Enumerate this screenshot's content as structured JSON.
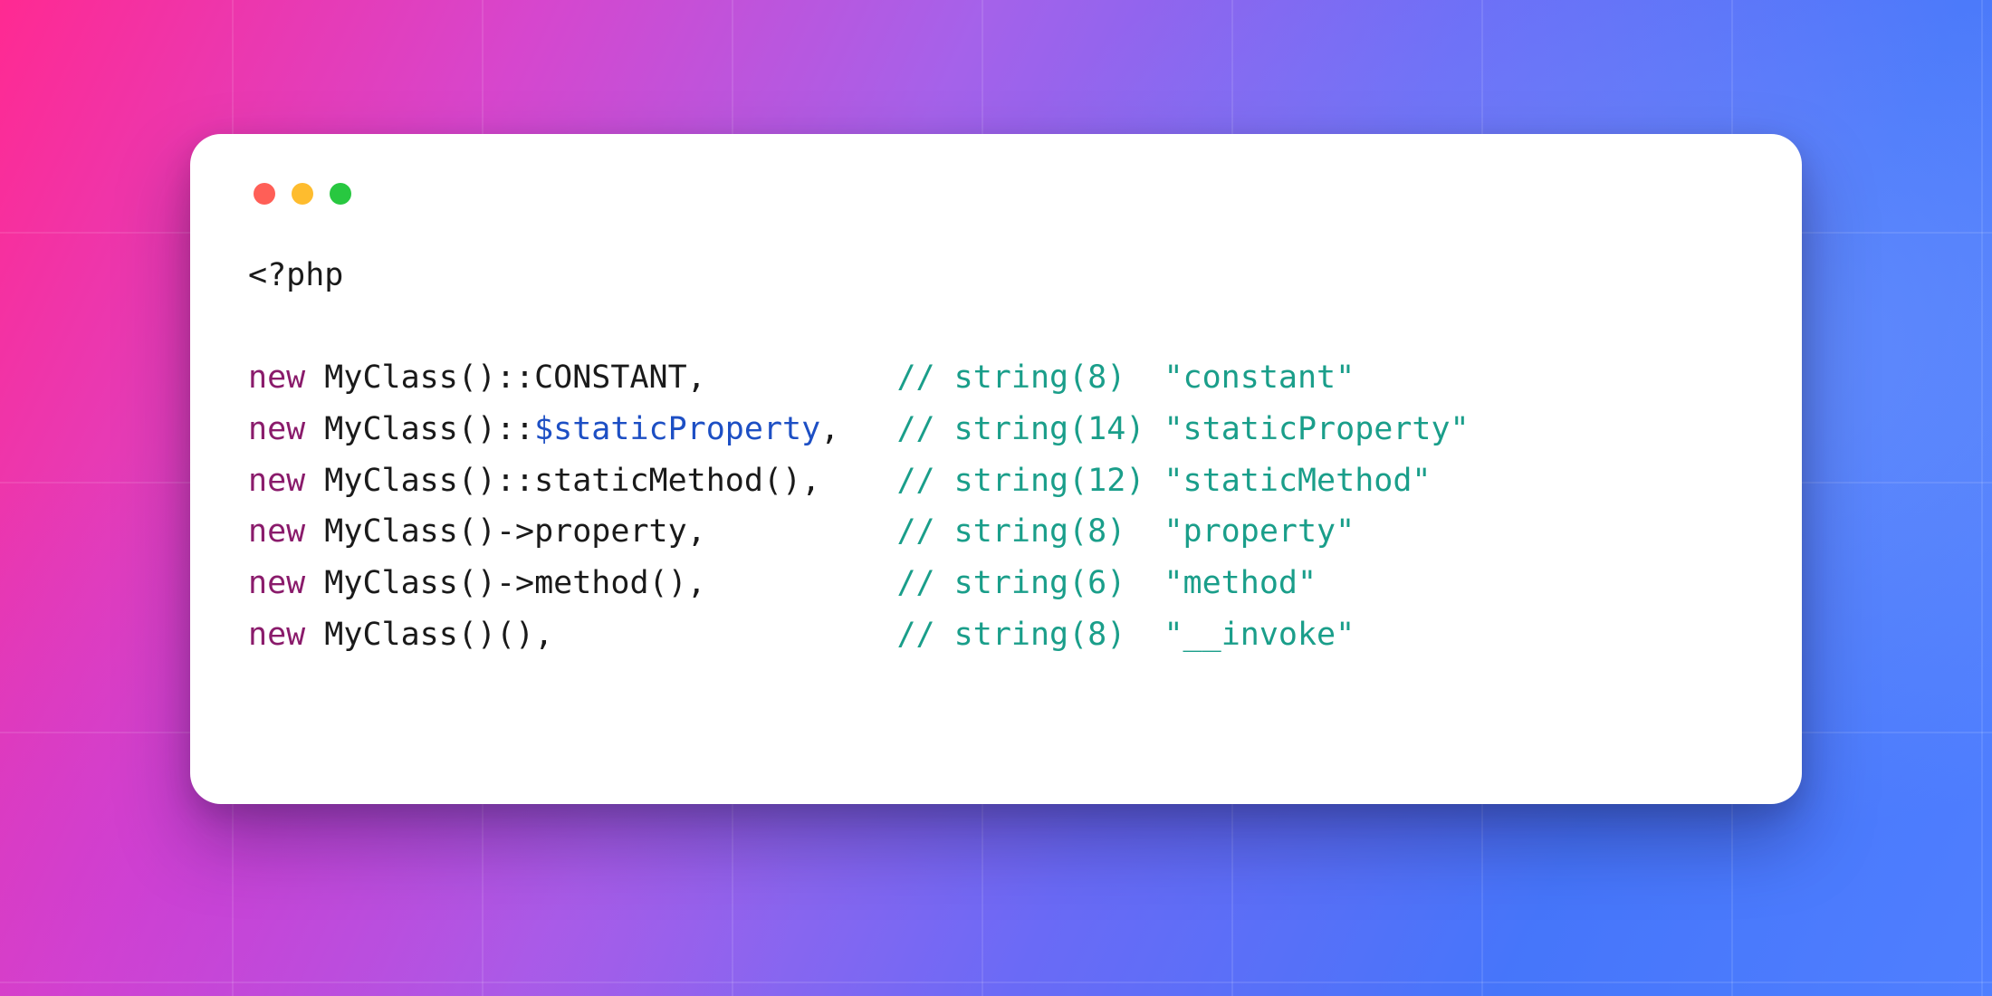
{
  "php_open": "<?php",
  "code_column_width": 34,
  "lines": [
    {
      "tokens": [
        {
          "t": "new ",
          "cls": "kw"
        },
        {
          "t": "MyClass()::CONSTANT,",
          "cls": "plain"
        }
      ],
      "comment": "// string(8)  \"constant\""
    },
    {
      "tokens": [
        {
          "t": "new ",
          "cls": "kw"
        },
        {
          "t": "MyClass()::",
          "cls": "plain"
        },
        {
          "t": "$staticProperty",
          "cls": "var"
        },
        {
          "t": ",",
          "cls": "plain"
        }
      ],
      "comment": "// string(14) \"staticProperty\""
    },
    {
      "tokens": [
        {
          "t": "new ",
          "cls": "kw"
        },
        {
          "t": "MyClass()::staticMethod(),",
          "cls": "plain"
        }
      ],
      "comment": "// string(12) \"staticMethod\""
    },
    {
      "tokens": [
        {
          "t": "new ",
          "cls": "kw"
        },
        {
          "t": "MyClass()->property,",
          "cls": "plain"
        }
      ],
      "comment": "// string(8)  \"property\""
    },
    {
      "tokens": [
        {
          "t": "new ",
          "cls": "kw"
        },
        {
          "t": "MyClass()->method(),",
          "cls": "plain"
        }
      ],
      "comment": "// string(6)  \"method\""
    },
    {
      "tokens": [
        {
          "t": "new ",
          "cls": "kw"
        },
        {
          "t": "MyClass()(),",
          "cls": "plain"
        }
      ],
      "comment": "// string(8)  \"__invoke\""
    }
  ]
}
